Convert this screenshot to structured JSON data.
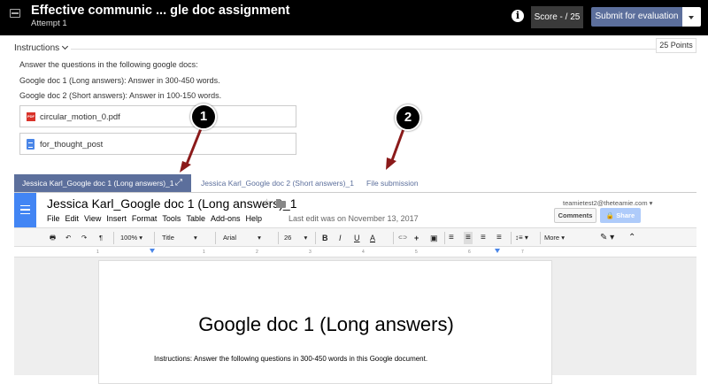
{
  "topbar": {
    "title": "Effective communic ... gle doc assignment",
    "attempt": "Attempt 1",
    "info_glyph": "i",
    "score": "Score - / 25",
    "submit": "Submit for evaluation"
  },
  "instructions": {
    "header": "Instructions",
    "points": "25 Points",
    "lines": [
      "Answer the questions in the following google docs:",
      "Google doc 1 (Long answers): Answer in 300-450 words.",
      "Google doc 2 (Short answers): Answer in 100-150 words."
    ],
    "files": [
      {
        "name": "circular_motion_0.pdf",
        "icon": "pdf-icon",
        "badge": "PDF"
      },
      {
        "name": "for_thought_post",
        "icon": "google-doc-icon"
      }
    ]
  },
  "callouts": [
    "1",
    "2"
  ],
  "tabs": {
    "active": "Jessica Karl_Google doc 1 (Long answers)_1",
    "second": "Jessica Karl_Google doc 2 (Short answers)_1",
    "third": "File submission",
    "expand_glyph": "⤢"
  },
  "gdoc": {
    "title": "Jessica Karl_Google doc 1 (Long answers)_1",
    "star_glyph": "☆",
    "menu": [
      "File",
      "Edit",
      "View",
      "Insert",
      "Format",
      "Tools",
      "Table",
      "Add-ons",
      "Help"
    ],
    "last_edit": "Last edit was on November 13, 2017",
    "account": "teamietest2@theteamie.com ▾",
    "comments": "Comments",
    "share": "🔒 Share",
    "toolbar": {
      "zoom": "100%",
      "style": "Title",
      "font": "Arial",
      "size": "26",
      "bold": "B",
      "italic": "I",
      "underline": "U",
      "textcolor": "A",
      "more": "More",
      "print": "🖶",
      "undo": "↶",
      "redo": "↷",
      "paint": "¶",
      "link": "⊂⊃",
      "comment": "+",
      "image": "▣",
      "align_left": "≡",
      "align_center": "≡",
      "align_right": "≡",
      "justify": "≡",
      "spacing": "↕≡",
      "pen": "✎",
      "collapse": "⌃",
      "caret": "▾"
    },
    "ruler": [
      "1",
      "1",
      "2",
      "3",
      "4",
      "5",
      "6",
      "7"
    ],
    "page_title": "Google doc 1 (Long answers)",
    "page_line_label": "Instructions:",
    "page_line_text": " Answer the following questions in 300-450 words in this Google document."
  },
  "colors": {
    "accent": "#5c6f9c",
    "callout_arrow": "#8b1a1a"
  }
}
